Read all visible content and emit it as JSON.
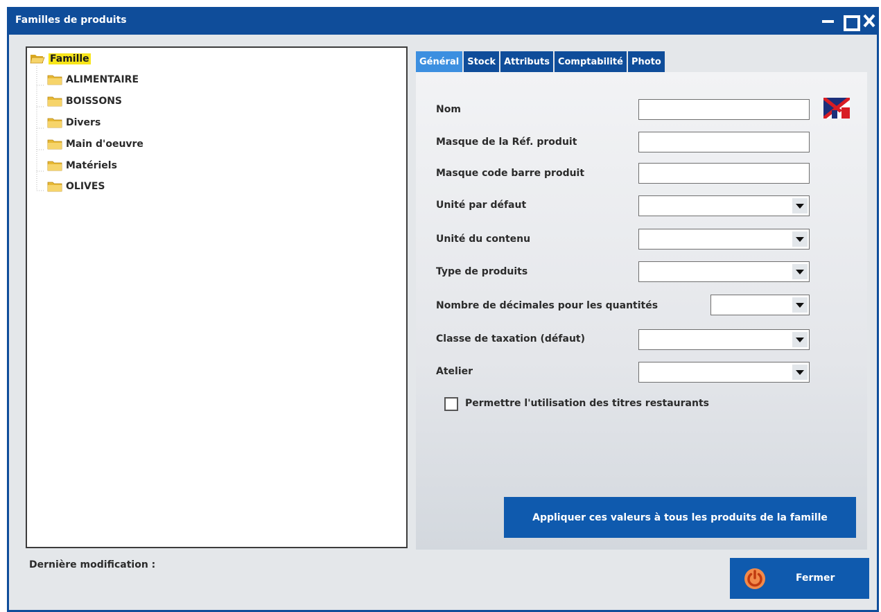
{
  "window": {
    "title": "Familles de produits",
    "accent_color": "#0f4d9a"
  },
  "tree": {
    "root": {
      "label": "Famille",
      "icon": "open-folder-icon",
      "selected": true
    },
    "items": [
      {
        "label": "ALIMENTAIRE",
        "icon": "folder-icon"
      },
      {
        "label": "BOISSONS",
        "icon": "folder-icon"
      },
      {
        "label": "Divers",
        "icon": "folder-icon"
      },
      {
        "label": "Main d'oeuvre",
        "icon": "folder-icon"
      },
      {
        "label": "Matériels",
        "icon": "folder-icon"
      },
      {
        "label": "OLIVES",
        "icon": "folder-icon"
      }
    ]
  },
  "tabs": [
    {
      "label": "Général",
      "active": true
    },
    {
      "label": "Stock",
      "active": false
    },
    {
      "label": "Attributs",
      "active": false
    },
    {
      "label": "Comptabilité",
      "active": false
    },
    {
      "label": "Photo",
      "active": false
    }
  ],
  "form": {
    "nom": {
      "label": "Nom",
      "value": ""
    },
    "masque_ref": {
      "label": "Masque de la Réf. produit",
      "value": ""
    },
    "masque_code_barre": {
      "label": "Masque code barre produit",
      "value": ""
    },
    "unite_defaut": {
      "label": "Unité par défaut",
      "value": ""
    },
    "unite_contenu": {
      "label": "Unité du contenu",
      "value": ""
    },
    "type_produits": {
      "label": "Type de produits",
      "value": ""
    },
    "nombre_decimales": {
      "label": "Nombre de décimales pour les quantités",
      "value": ""
    },
    "classe_taxation": {
      "label": "Classe de taxation (défaut)",
      "value": ""
    },
    "atelier": {
      "label": "Atelier",
      "value": ""
    },
    "titres_restaurants": {
      "label": "Permettre l'utilisation des titres restaurants",
      "checked": false
    },
    "language_flag_icon": "uk-france-flag-icon"
  },
  "actions": {
    "apply_label": "Appliquer ces valeurs à tous les produits de la famille",
    "close_label": "Fermer",
    "close_icon": "power-icon"
  },
  "footer": {
    "last_modified_label": "Dernière modification :"
  }
}
